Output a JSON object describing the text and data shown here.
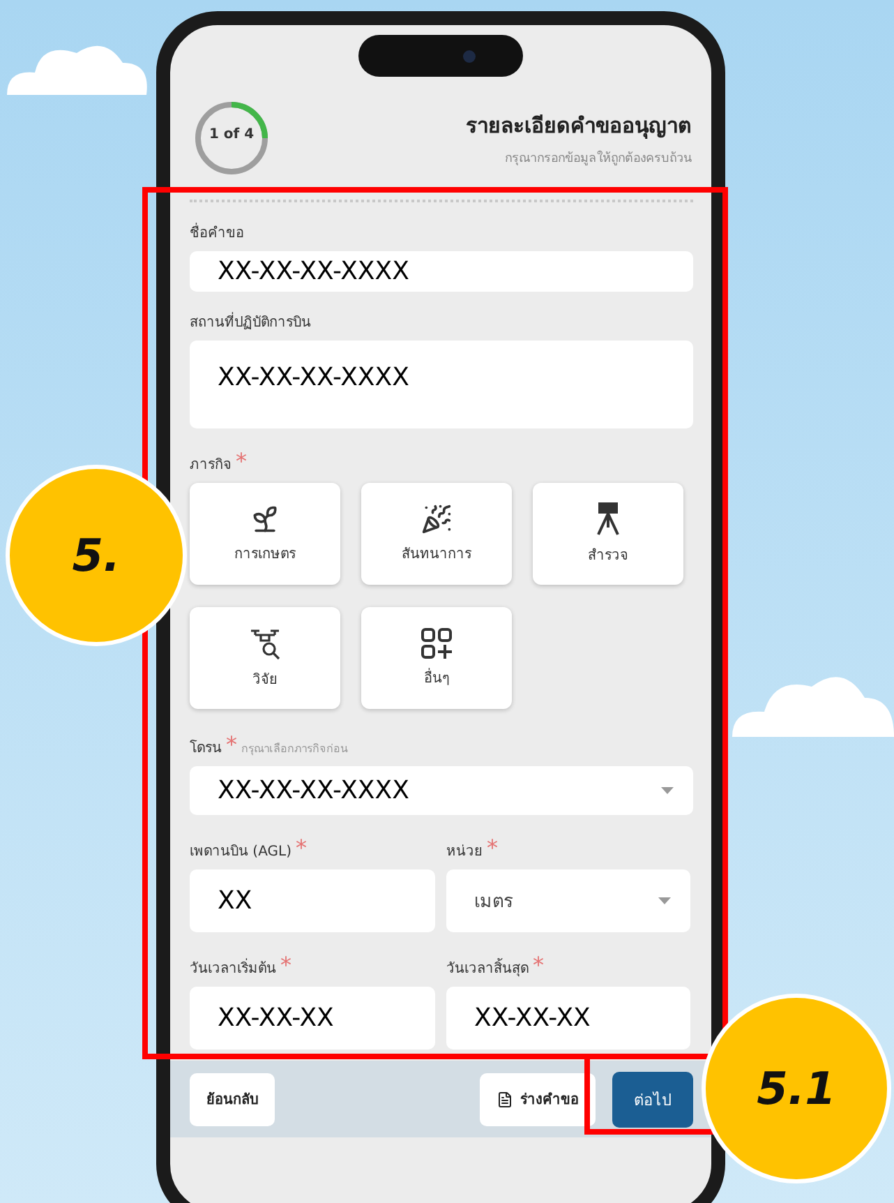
{
  "header": {
    "progress": {
      "label": "1 of 4",
      "level": 0.25
    },
    "title": "รายละเอียดคำขออนุญาต",
    "subtitle": "กรุณากรอกข้อมูลให้ถูกต้องครบถ้วน"
  },
  "form": {
    "request_name": {
      "label": "ชื่อคำขอ",
      "value": "XX-XX-XX-XXXX"
    },
    "flight_location": {
      "label": "สถานที่ปฏิบัติการบิน",
      "value": "XX-XX-XX-XXXX"
    },
    "mission": {
      "label": "ภารกิจ",
      "required_mark": "*",
      "options": [
        {
          "kind": "farm",
          "label": "การเกษตร"
        },
        {
          "kind": "event",
          "label": "สันทนาการ"
        },
        {
          "kind": "survey",
          "label": "สำรวจ"
        },
        {
          "kind": "research",
          "label": "วิจัย"
        },
        {
          "kind": "other",
          "label": "อื่นๆ"
        }
      ]
    },
    "drone": {
      "label": "โดรน",
      "required_mark": "*",
      "hint": "กรุณาเลือกภารกิจก่อน",
      "value": "XX-XX-XX-XXXX"
    },
    "ceiling": {
      "label": "เพดานบิน (AGL)",
      "required_mark": "*",
      "value": "XX"
    },
    "unit": {
      "label": "หน่วย",
      "required_mark": "*",
      "value": "เมตร"
    },
    "start": {
      "label": "วันเวลาเริ่มต้น",
      "required_mark": "*",
      "value": "XX-XX-XX"
    },
    "end": {
      "label": "วันเวลาสิ้นสุด",
      "required_mark": "*",
      "value": "XX-XX-XX"
    }
  },
  "footer": {
    "back": "ย้อนกลับ",
    "draft": "ร่างคำขอ",
    "next": "ต่อไป"
  },
  "annotations": [
    {
      "label": "5."
    },
    {
      "label": "5.1"
    }
  ]
}
